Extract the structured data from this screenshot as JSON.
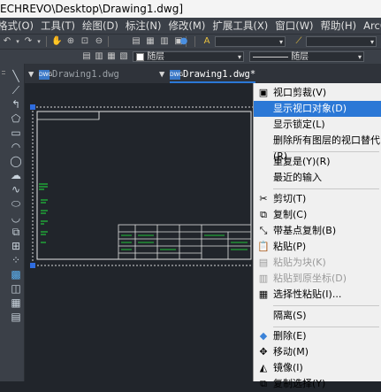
{
  "window": {
    "title": "ECHREVO\\Desktop\\Drawing1.dwg]"
  },
  "menubar": {
    "items": [
      "格式(O)",
      "工具(T)",
      "绘图(D)",
      "标注(N)",
      "修改(M)",
      "扩展工具(X)",
      "窗口(W)",
      "帮助(H)",
      "ArcGIS"
    ]
  },
  "toolbar2": {
    "layer_value": "随层",
    "linetype_value": "随层"
  },
  "tabs": [
    {
      "label": "Drawing1.dwg",
      "icon": "dwg-file-icon",
      "active": false
    },
    {
      "label": "Drawing1.dwg*",
      "icon": "dwg-file-icon",
      "active": true
    }
  ],
  "context_menu": {
    "items": [
      {
        "label": "视口剪裁(V)",
        "icon": "viewport-clip-icon",
        "state": "normal"
      },
      {
        "label": "显示视口对象(D)",
        "icon": "",
        "state": "highlighted"
      },
      {
        "label": "显示锁定(L)",
        "icon": "",
        "state": "normal"
      },
      {
        "label": "删除所有图层的视口替代(R)",
        "icon": "",
        "state": "normal"
      },
      {
        "label": "重复是(Y)(R)",
        "icon": "",
        "state": "normal"
      },
      {
        "label": "最近的输入",
        "icon": "",
        "state": "normal"
      },
      {
        "label": "剪切(T)",
        "icon": "scissors-icon",
        "state": "normal"
      },
      {
        "label": "复制(C)",
        "icon": "copy-icon",
        "state": "normal"
      },
      {
        "label": "带基点复制(B)",
        "icon": "copy-base-point-icon",
        "state": "normal"
      },
      {
        "label": "粘贴(P)",
        "icon": "paste-icon",
        "state": "normal"
      },
      {
        "label": "粘贴为块(K)",
        "icon": "paste-block-icon",
        "state": "disabled"
      },
      {
        "label": "粘贴到原坐标(D)",
        "icon": "paste-original-icon",
        "state": "disabled"
      },
      {
        "label": "选择性粘贴(I)...",
        "icon": "paste-special-icon",
        "state": "normal"
      },
      {
        "label": "隔离(S)",
        "icon": "",
        "state": "normal"
      },
      {
        "label": "删除(E)",
        "icon": "eraser-icon",
        "state": "normal"
      },
      {
        "label": "移动(M)",
        "icon": "move-icon",
        "state": "normal"
      },
      {
        "label": "镜像(I)",
        "icon": "mirror-icon",
        "state": "normal"
      },
      {
        "label": "复制选择(Y)",
        "icon": "copy-select-icon",
        "state": "normal"
      }
    ]
  },
  "colors": {
    "highlight": "#2b78d6",
    "canvas": "#21252b",
    "accent_green": "#21c43a"
  }
}
